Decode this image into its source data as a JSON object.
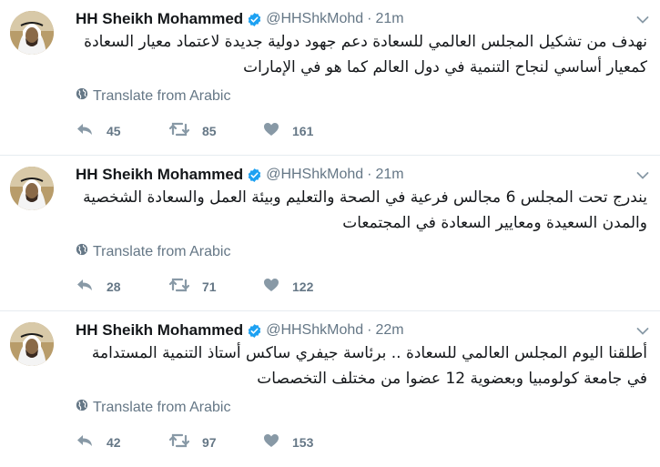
{
  "tweets": [
    {
      "name": "HH Sheikh Mohammed",
      "handle": "@HHShkMohd",
      "separator": "·",
      "time": "21m",
      "text": "نهدف من تشكيل المجلس العالمي للسعادة دعم جهود دولية جديدة لاعتماد معيار السعادة كمعيار أساسي لنجاح التنمية في دول العالم كما هو في الإمارات",
      "translate": "Translate from Arabic",
      "replies": "45",
      "retweets": "85",
      "likes": "161"
    },
    {
      "name": "HH Sheikh Mohammed",
      "handle": "@HHShkMohd",
      "separator": "·",
      "time": "21m",
      "text": "يندرج تحت المجلس 6 مجالس فرعية في الصحة والتعليم وبيئة العمل والسعادة الشخصية والمدن السعيدة ومعايير السعادة في المجتمعات",
      "translate": "Translate from Arabic",
      "replies": "28",
      "retweets": "71",
      "likes": "122"
    },
    {
      "name": "HH Sheikh Mohammed",
      "handle": "@HHShkMohd",
      "separator": "·",
      "time": "22m",
      "text": "أطلقنا اليوم المجلس العالمي للسعادة .. برئاسة جيفري ساكس أستاذ التنمية المستدامة في جامعة كولومبيا وبعضوية 12 عضوا من مختلف التخصصات",
      "translate": "Translate from Arabic",
      "replies": "42",
      "retweets": "97",
      "likes": "153"
    }
  ],
  "icons": {
    "verified": "verified-badge-icon",
    "caret": "chevron-down-icon",
    "globe": "globe-icon",
    "reply": "reply-icon",
    "retweet": "retweet-icon",
    "like": "heart-icon"
  },
  "colors": {
    "verified": "#1da1f2",
    "muted": "#657786",
    "text": "#14171a",
    "divider": "#e6ecf0"
  }
}
